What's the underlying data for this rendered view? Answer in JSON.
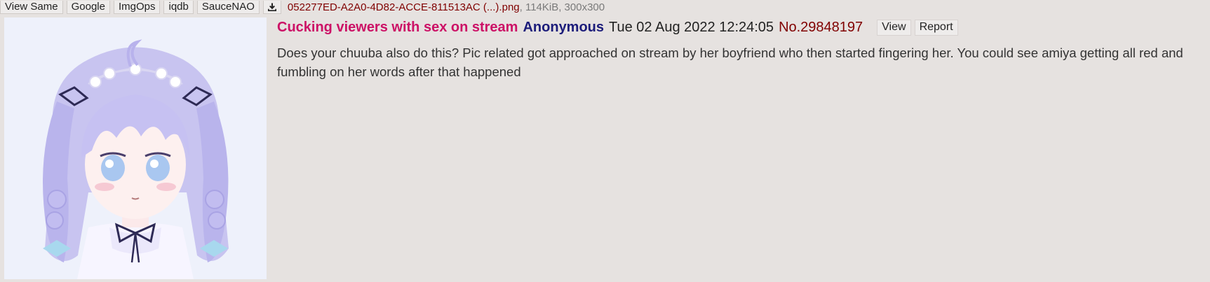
{
  "file_bar": {
    "buttons": [
      "View Same",
      "Google",
      "ImgOps",
      "iqdb",
      "SauceNAO"
    ],
    "download_icon": "download-icon",
    "file_name": "052277ED-A2A0-4D82-ACCE-811513AC (...).png",
    "file_meta": ", 114KiB, 300x300"
  },
  "post": {
    "subject": "Cucking viewers with sex on stream",
    "name": "Anonymous",
    "date": "Tue 02 Aug 2022 12:24:05",
    "number": "No.29848197",
    "view_label": "View",
    "report_label": "Report",
    "body": "Does your chuuba also do this? Pic related got approached on stream by her boyfriend who then started fingering her. You could see amiya getting all red and fumbling on her words after that happened"
  },
  "colors": {
    "background": "#e6e2e0",
    "subject": "#cc1166",
    "name": "#1c1c7a",
    "post_number": "#800000",
    "file_name": "#800000",
    "meta": "#7a7a7a"
  }
}
